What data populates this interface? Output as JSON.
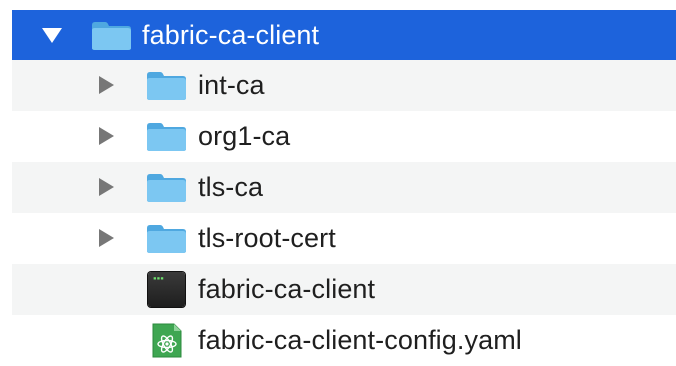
{
  "tree": {
    "root": {
      "label": "fabric-ca-client",
      "icon": "folder-icon",
      "expanded": true,
      "selected": true
    },
    "children": [
      {
        "label": "int-ca",
        "icon": "folder-icon",
        "expandable": true
      },
      {
        "label": "org1-ca",
        "icon": "folder-icon",
        "expandable": true
      },
      {
        "label": "tls-ca",
        "icon": "folder-icon",
        "expandable": true
      },
      {
        "label": "tls-root-cert",
        "icon": "folder-icon",
        "expandable": true
      },
      {
        "label": "fabric-ca-client",
        "icon": "terminal-executable-icon",
        "expandable": false
      },
      {
        "label": "fabric-ca-client-config.yaml",
        "icon": "atom-yaml-file-icon",
        "expandable": false
      }
    ]
  },
  "colors": {
    "selection": "#1d63dc",
    "folder": "#61b8ec",
    "stripe": "#f4f5f5"
  }
}
